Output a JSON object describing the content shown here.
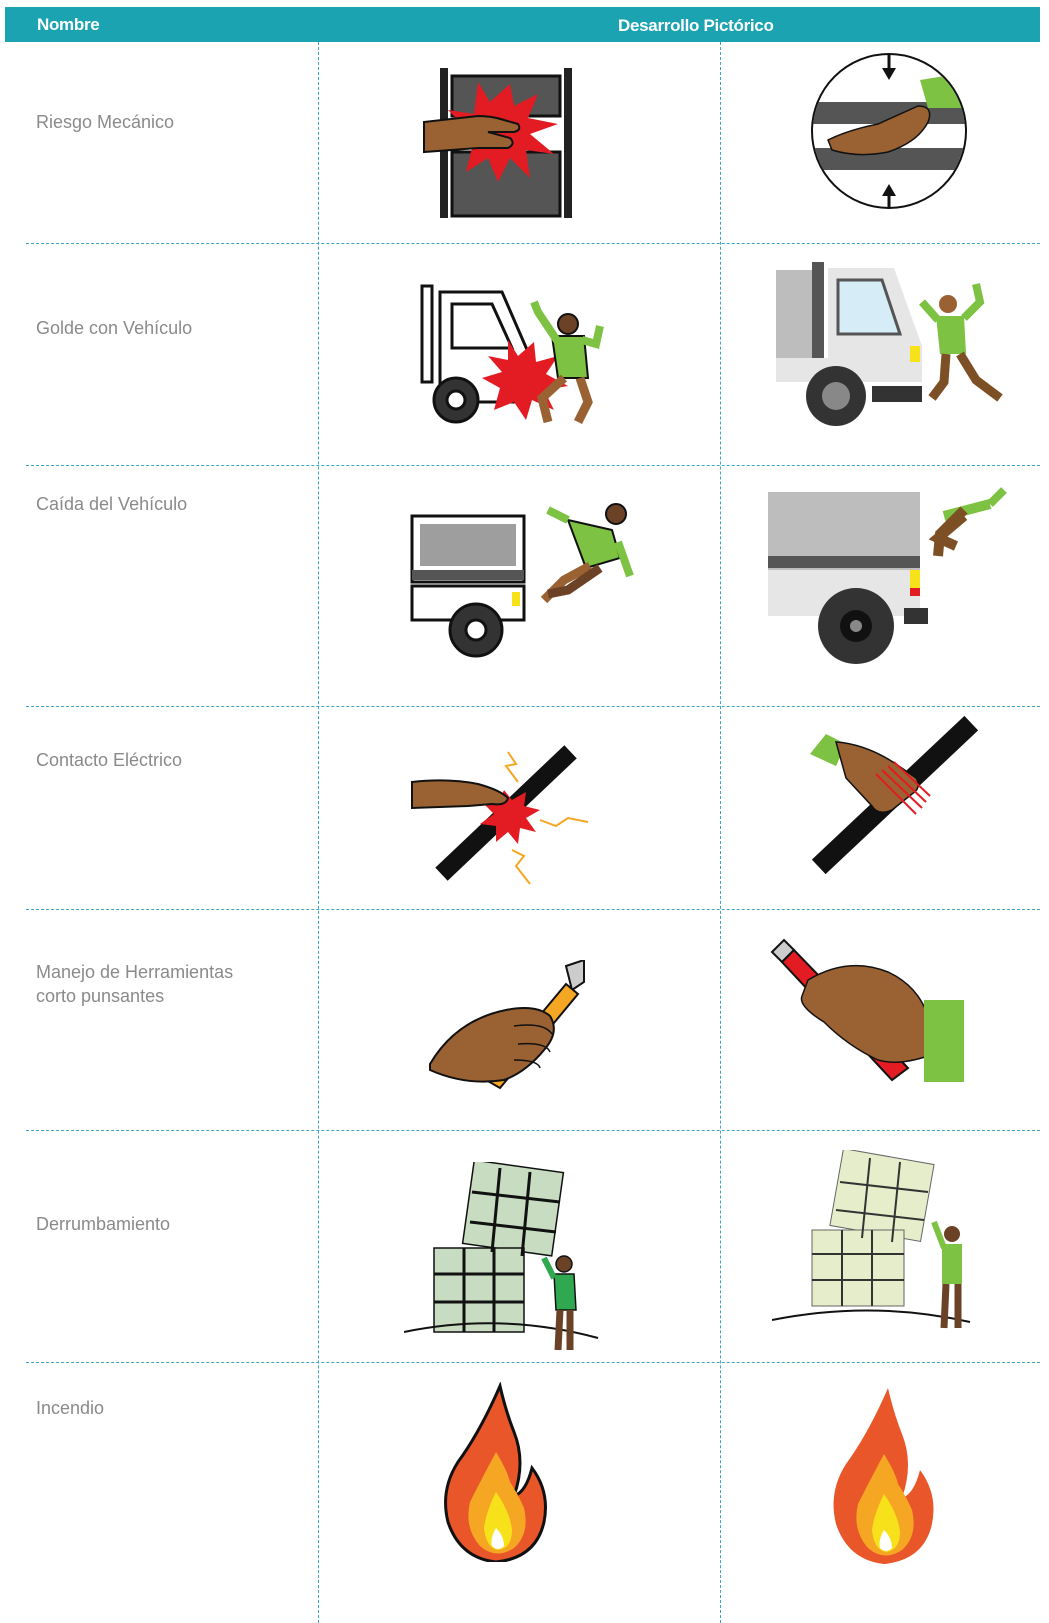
{
  "header": {
    "name_label": "Nombre",
    "pictorial_label": "Desarrollo Pictórico",
    "color": "#1ba3b2"
  },
  "rows": [
    {
      "name": "Riesgo Mecánico",
      "left_icon": "hand-crush-icon",
      "right_icon": "hand-pinch-circle-icon"
    },
    {
      "name": "Golde con Vehículo",
      "left_icon": "truck-hit-person-icon",
      "right_icon": "truck-person-icon"
    },
    {
      "name": "Caída del Vehículo",
      "left_icon": "person-falling-truck-icon",
      "right_icon": "person-falling-truck-icon"
    },
    {
      "name": "Contacto Eléctrico",
      "left_icon": "electric-cable-touch-icon",
      "right_icon": "hand-grab-cable-icon"
    },
    {
      "name": "Manejo de Herramientas\ncorto punsantes",
      "left_icon": "hand-cutter-icon",
      "right_icon": "hand-cutter-icon"
    },
    {
      "name": "Derrumbamiento",
      "left_icon": "collapse-bales-person-icon",
      "right_icon": "collapse-bales-person-icon"
    },
    {
      "name": "Incendio",
      "left_icon": "fire-icon",
      "right_icon": "fire-icon"
    }
  ]
}
